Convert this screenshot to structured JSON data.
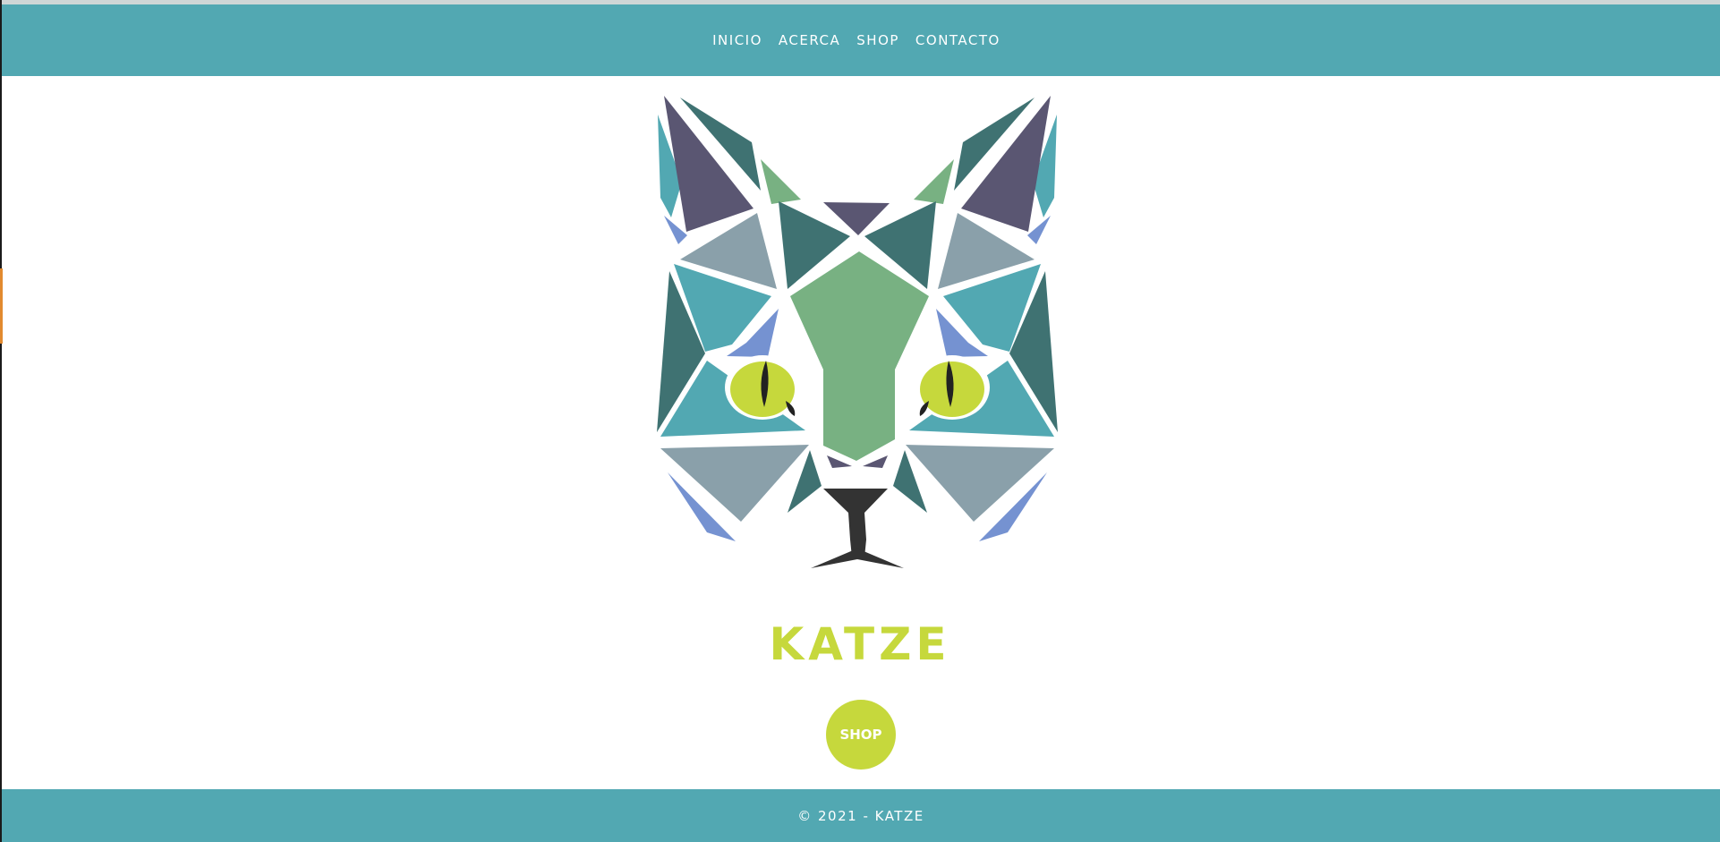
{
  "nav": {
    "items": [
      {
        "label": "INICIO"
      },
      {
        "label": "ACERCA"
      },
      {
        "label": "SHOP"
      },
      {
        "label": "CONTACTO"
      }
    ]
  },
  "hero": {
    "logo_icon": "geometric-cat-head-icon",
    "title": "KATZE",
    "shop_button_label": "SHOP"
  },
  "footer": {
    "text": "© 2021 - KATZE"
  },
  "colors": {
    "nav_bg": "#52a8b2",
    "footer_bg": "#52a8b2",
    "accent": "#c6d83c",
    "cat_teal": "#52a8b2",
    "cat_dark_teal": "#3f7272",
    "cat_purple": "#5a5672",
    "cat_gray_blue": "#8aa0aa",
    "cat_green": "#78b182",
    "cat_blue": "#7592d1",
    "cat_eye": "#c6d83c",
    "cat_nose": "#333333"
  }
}
